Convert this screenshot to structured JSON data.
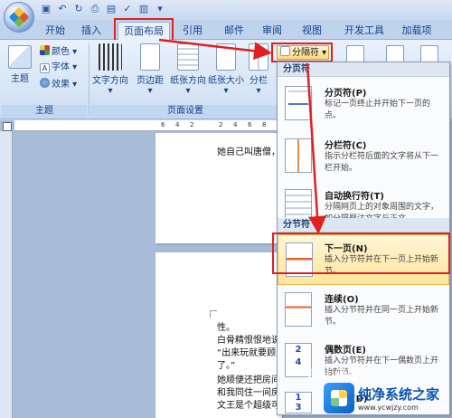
{
  "tabs": [
    {
      "label": "开始"
    },
    {
      "label": "插入"
    },
    {
      "label": "页面布局"
    },
    {
      "label": "引用"
    },
    {
      "label": "邮件"
    },
    {
      "label": "审阅"
    },
    {
      "label": "视图"
    },
    {
      "label": "开发工具"
    },
    {
      "label": "加载项"
    }
  ],
  "ribbon": {
    "theme_group": {
      "main_button": "主题",
      "colors": "颜色",
      "fonts": "字体",
      "effects": "效果",
      "label": "主题"
    },
    "page_setup_group": {
      "text_direction": "文字方向",
      "margins": "页边距",
      "orientation": "纸张方向",
      "size": "纸张大小",
      "columns": "分栏",
      "label": "页面设置"
    },
    "breaks_button": "分隔符"
  },
  "document": {
    "ruler_ticks": [
      "6",
      "4",
      "2",
      "2",
      "4",
      "6",
      "8"
    ],
    "page1_lines": [
      "她自己叫唐僧，"
    ],
    "page2_lines": [
      "性。",
      "白骨精恨恨地说",
      "“出来玩就要顾",
      "了。”",
      "她顺便还把房间",
      "和我同住一间房",
      "文王是个超级可"
    ]
  },
  "menu": {
    "section_page_breaks": "分页符",
    "section_section_breaks": "分节符",
    "items": [
      {
        "title": "分页符(P)",
        "desc": "标记一页终止并开始下一页的点。"
      },
      {
        "title": "分栏符(C)",
        "desc": "指示分栏符后面的文字将从下一栏开始。"
      },
      {
        "title": "自动换行符(T)",
        "desc": "分隔网页上的对象周围的文字，如分隔题注文字与正文。"
      },
      {
        "title": "下一页(N)",
        "desc": "插入分节符并在下一页上开始新节。"
      },
      {
        "title": "连续(O)",
        "desc": "插入分节符并在同一页上开始新节。"
      },
      {
        "title": "偶数页(E)",
        "desc": "插入分节符并在下一偶数页上开始新节。"
      },
      {
        "title": "奇数页(D)",
        "desc": ""
      }
    ]
  },
  "watermark": {
    "brand": "纯净系统之家",
    "url": "www.ycwjzy.com",
    "baidu": "Bai 经验"
  },
  "colors": {
    "highlight_red": "#e02020",
    "ribbon_text": "#15428b",
    "menu_highlight": "#ffe49a"
  }
}
